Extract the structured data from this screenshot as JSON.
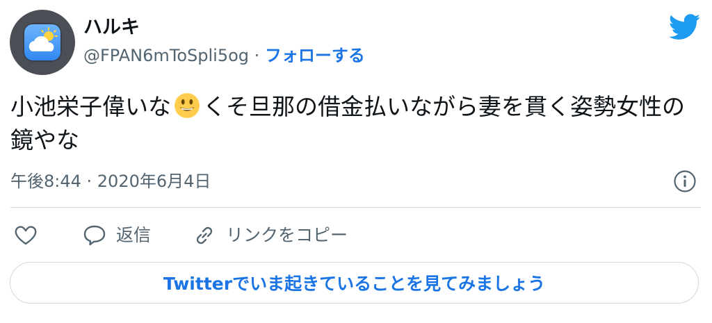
{
  "author": {
    "display_name": "ハルキ",
    "handle": "@FPAN6mToSpli5og",
    "separator": " · ",
    "follow_label": "フォローする"
  },
  "tweet": {
    "text_part1": "小池栄子偉いな",
    "text_part2": "くそ旦那の借金払いながら妻を貫く姿勢女性の鏡やな",
    "emoji": "grinning-face",
    "timestamp": "午後8:44 · 2020年6月4日"
  },
  "actions": {
    "like_icon": "heart-icon",
    "reply_label": "返信",
    "copy_link_label": "リンクをコピー"
  },
  "cta": {
    "label": "Twitterでいま起きていることを見てみましょう"
  },
  "colors": {
    "accent": "#1b74e4",
    "twitter_bird": "#1d9bf0",
    "secondary_text": "#536471",
    "divider": "#cfd9de"
  }
}
